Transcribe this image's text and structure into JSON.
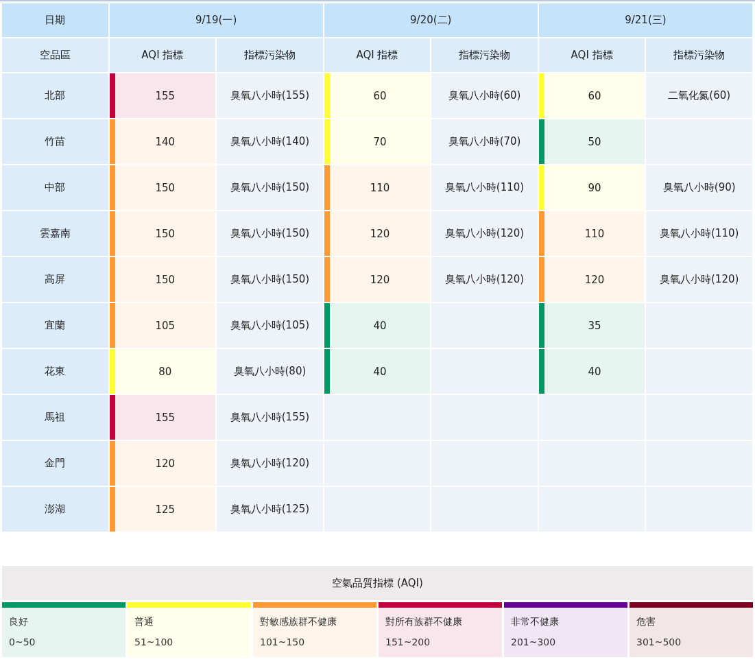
{
  "table": {
    "date_header": "日期",
    "region_header": "空品區",
    "dates": [
      "9/19(一)",
      "9/20(二)",
      "9/21(三)"
    ],
    "sub_headers": [
      [
        "AQI 指標",
        "指標污染物"
      ],
      [
        "AQI 指標",
        "指標污染物"
      ],
      [
        "AQI 指標",
        "指標污染物"
      ]
    ],
    "rows": [
      {
        "region": "北部",
        "days": [
          {
            "aqi": "155",
            "pollutant": "臭氧八小時(155)",
            "color": "#c4003c"
          },
          {
            "aqi": "60",
            "pollutant": "臭氧八小時(60)",
            "color": "#ffff33"
          },
          {
            "aqi": "60",
            "pollutant": "二氧化氮(60)",
            "color": "#ffff33"
          }
        ]
      },
      {
        "region": "竹苗",
        "days": [
          {
            "aqi": "140",
            "pollutant": "臭氧八小時(140)",
            "color": "#ff9933"
          },
          {
            "aqi": "70",
            "pollutant": "臭氧八小時(70)",
            "color": "#ffff33"
          },
          {
            "aqi": "50",
            "color": "#009966"
          }
        ]
      },
      {
        "region": "中部",
        "days": [
          {
            "aqi": "150",
            "pollutant": "臭氧八小時(150)",
            "color": "#ff9933"
          },
          {
            "aqi": "110",
            "pollutant": "臭氧八小時(110)",
            "color": "#ff9933"
          },
          {
            "aqi": "90",
            "pollutant": "臭氧八小時(90)",
            "color": "#ffff33"
          }
        ]
      },
      {
        "region": "雲嘉南",
        "days": [
          {
            "aqi": "150",
            "pollutant": "臭氧八小時(150)",
            "color": "#ff9933"
          },
          {
            "aqi": "120",
            "pollutant": "臭氧八小時(120)",
            "color": "#ff9933"
          },
          {
            "aqi": "110",
            "pollutant": "臭氧八小時(110)",
            "color": "#ff9933"
          }
        ]
      },
      {
        "region": "高屏",
        "days": [
          {
            "aqi": "150",
            "pollutant": "臭氧八小時(150)",
            "color": "#ff9933"
          },
          {
            "aqi": "120",
            "pollutant": "臭氧八小時(120)",
            "color": "#ff9933"
          },
          {
            "aqi": "120",
            "pollutant": "臭氧八小時(120)",
            "color": "#ff9933"
          }
        ]
      },
      {
        "region": "宜蘭",
        "days": [
          {
            "aqi": "105",
            "pollutant": "臭氧八小時(105)",
            "color": "#ff9933"
          },
          {
            "aqi": "40",
            "color": "#009966"
          },
          {
            "aqi": "35",
            "color": "#009966"
          }
        ]
      },
      {
        "region": "花東",
        "days": [
          {
            "aqi": "80",
            "pollutant": "臭氧八小時(80)",
            "color": "#ffff33"
          },
          {
            "aqi": "40",
            "color": "#009966"
          },
          {
            "aqi": "40",
            "color": "#009966"
          }
        ]
      },
      {
        "region": "馬祖",
        "days": [
          {
            "aqi": "155",
            "pollutant": "臭氧八小時(155)",
            "color": "#c4003c"
          }
        ]
      },
      {
        "region": "金門",
        "days": [
          {
            "aqi": "120",
            "pollutant": "臭氧八小時(120)",
            "color": "#ff9933"
          }
        ]
      },
      {
        "region": "澎湖",
        "days": [
          {
            "aqi": "125",
            "pollutant": "臭氧八小時(125)",
            "color": "#ff9933"
          }
        ]
      }
    ]
  },
  "legend": {
    "title": "空氣品質指標 (AQI)",
    "items": [
      {
        "label": "良好",
        "range": "0~50",
        "color": "#009966"
      },
      {
        "label": "普通",
        "range": "51~100",
        "color": "#ffff33"
      },
      {
        "label": "對敏感族群不健康",
        "range": "101~150",
        "color": "#ff9933"
      },
      {
        "label": "對所有族群不健康",
        "range": "151~200",
        "color": "#c4003c"
      },
      {
        "label": "非常不健康",
        "range": "201~300",
        "color": "#660099"
      },
      {
        "label": "危害",
        "range": "301~500",
        "color": "#7e0023"
      }
    ]
  }
}
